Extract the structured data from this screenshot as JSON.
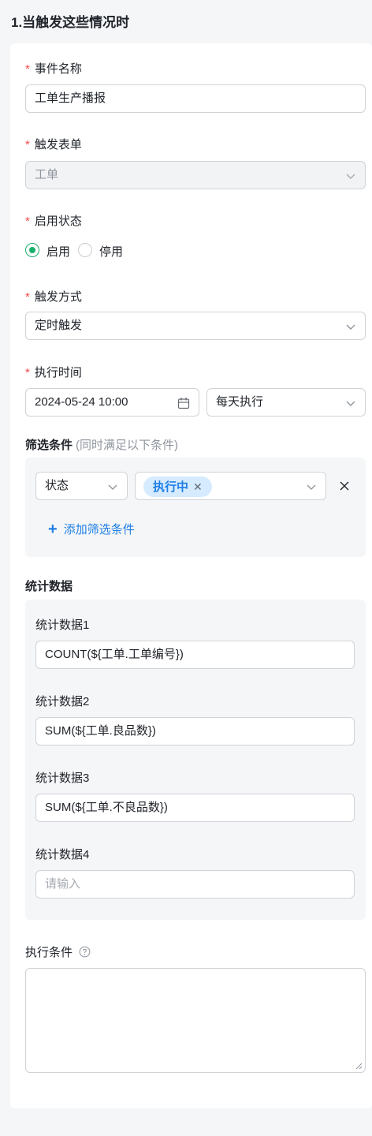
{
  "section_title": "1.当触发这些情况时",
  "required_mark": "*",
  "fields": {
    "event_name": {
      "label": "事件名称",
      "value": "工单生产播报"
    },
    "trigger_form": {
      "label": "触发表单",
      "value": "工单"
    },
    "status": {
      "label": "启用状态",
      "options": [
        "启用",
        "停用"
      ],
      "selected": "启用"
    },
    "trigger_mode": {
      "label": "触发方式",
      "value": "定时触发"
    },
    "exec_time": {
      "label": "执行时间",
      "datetime": "2024-05-24 10:00",
      "frequency": "每天执行"
    }
  },
  "filter": {
    "label": "筛选条件",
    "hint": "(同时满足以下条件)",
    "field": "状态",
    "tag": "执行中",
    "add_label": "添加筛选条件"
  },
  "stats": {
    "label": "统计数据",
    "items": [
      {
        "label": "统计数据1",
        "value": "COUNT(${工单.工单编号})"
      },
      {
        "label": "统计数据2",
        "value": "SUM(${工单.良品数})"
      },
      {
        "label": "统计数据3",
        "value": "SUM(${工单.不良品数})"
      },
      {
        "label": "统计数据4",
        "value": "",
        "placeholder": "请输入"
      }
    ]
  },
  "exec_condition": {
    "label": "执行条件",
    "value": ""
  },
  "icons": {
    "chevron": "chevron-down-icon",
    "calendar": "calendar-icon",
    "close": "close-icon",
    "plus": "plus-icon",
    "help": "help-circle-icon"
  },
  "colors": {
    "accent": "#1aaf6c",
    "link": "#1f7fe5",
    "required": "#f54a45",
    "tag_bg": "#d6ebff"
  }
}
